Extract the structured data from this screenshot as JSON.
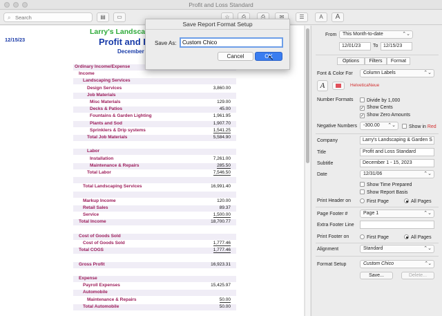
{
  "window": {
    "title": "Profit and Loss Standard"
  },
  "toolbar": {
    "search_placeholder": "Search",
    "search_icon": "magnifier-icon",
    "buttons": [
      "customize-report-icon",
      "sidebar-icon",
      "star-icon",
      "memorize-icon",
      "print-icon",
      "email-icon",
      "comment-icon",
      "font-small-icon",
      "font-large-icon"
    ],
    "font_small_glyph": "A",
    "font_large_glyph": "A"
  },
  "report": {
    "date": "12/15/23",
    "company": "Larry's Landscaping",
    "title": "Profit and Lo",
    "subtitle": "December",
    "rows": [
      {
        "label": "Ordinary Income/Expense",
        "amount": "",
        "indent": 0
      },
      {
        "label": "Income",
        "amount": "",
        "indent": 1
      },
      {
        "label": "Landscaping Services",
        "amount": "",
        "indent": 2
      },
      {
        "label": "Design Services",
        "amount": "3,860.00",
        "indent": 3
      },
      {
        "label": "Job Materials",
        "amount": "",
        "indent": 3
      },
      {
        "label": "Misc Materials",
        "amount": "129.00",
        "indent": 4
      },
      {
        "label": "Decks & Patios",
        "amount": "45.00",
        "indent": 4
      },
      {
        "label": "Fountains & Garden Lighting",
        "amount": "1,961.95",
        "indent": 4
      },
      {
        "label": "Plants and Sod",
        "amount": "1,907.70",
        "indent": 4
      },
      {
        "label": "Sprinklers & Drip systems",
        "amount": "1,541.25",
        "indent": 4
      },
      {
        "label": "Total Job Materials",
        "amount": "5,584.90",
        "indent": 3
      },
      {
        "label": "",
        "amount": "",
        "indent": 0
      },
      {
        "label": "Labor",
        "amount": "",
        "indent": 3
      },
      {
        "label": "Installation",
        "amount": "7,261.00",
        "indent": 4
      },
      {
        "label": "Maintenance & Repairs",
        "amount": "285.50",
        "indent": 4
      },
      {
        "label": "Total Labor",
        "amount": "7,546.50",
        "indent": 3
      },
      {
        "label": "",
        "amount": "",
        "indent": 0
      },
      {
        "label": "Total Landscaping Services",
        "amount": "16,991.40",
        "indent": 2
      },
      {
        "label": "",
        "amount": "",
        "indent": 0
      },
      {
        "label": "Markup Income",
        "amount": "120.00",
        "indent": 2
      },
      {
        "label": "Retail Sales",
        "amount": "89.37",
        "indent": 2
      },
      {
        "label": "Service",
        "amount": "1,500.00",
        "indent": 2
      },
      {
        "label": "Total Income",
        "amount": "18,700.77",
        "indent": 1
      },
      {
        "label": "",
        "amount": "",
        "indent": 0
      },
      {
        "label": "Cost of Goods Sold",
        "amount": "",
        "indent": 1
      },
      {
        "label": "Cost of Goods Sold",
        "amount": "1,777.46",
        "indent": 2
      },
      {
        "label": "Total COGS",
        "amount": "1,777.46",
        "indent": 1
      },
      {
        "label": "",
        "amount": "",
        "indent": 0
      },
      {
        "label": "Gross Profit",
        "amount": "16,923.31",
        "indent": 1
      },
      {
        "label": "",
        "amount": "",
        "indent": 0
      },
      {
        "label": "Expense",
        "amount": "",
        "indent": 1
      },
      {
        "label": "Payroll Expenses",
        "amount": "15,425.97",
        "indent": 2
      },
      {
        "label": "Automobile",
        "amount": "",
        "indent": 2
      },
      {
        "label": "Maintenance & Repairs",
        "amount": "50.00",
        "indent": 3
      },
      {
        "label": "Total Automobile",
        "amount": "50.00",
        "indent": 2
      }
    ]
  },
  "panel": {
    "from_label": "From",
    "date_range": "This Month-to-date",
    "from_date": "12/01/23",
    "to_label": "To",
    "to_date": "12/15/23",
    "tabs": [
      "Options",
      "Filters",
      "Format"
    ],
    "font_color_for_label": "Font & Color For",
    "font_color_for_value": "Column Labels",
    "font_glyph": "A",
    "font_name": "HelveticaNeue",
    "number_formats_label": "Number Formats",
    "divide_by_1000": "Divide by 1,000",
    "show_cents": "Show Cents",
    "show_zero_amounts": "Show Zero Amounts",
    "negative_numbers_label": "Negative Numbers",
    "negative_numbers_value": "-300.00",
    "show_in_red": "Show in",
    "red_word": "Red",
    "company_label": "Company",
    "company_value": "Larry's Landscaping & Garden S",
    "title_label": "Title",
    "title_value": "Profit and Loss Standard",
    "subtitle_label": "Subtitle",
    "subtitle_value": "December 1 - 15, 2023",
    "date_label": "Date",
    "date_value": "12/31/06",
    "show_time_prepared": "Show Time Prepared",
    "show_report_basis": "Show Report Basis",
    "print_header_on_label": "Print Header on",
    "first_page": "First Page",
    "all_pages": "All Pages",
    "page_footer_label": "Page Footer #",
    "page_footer_value": "Page 1",
    "extra_footer_label": "Extra Footer Line",
    "extra_footer_value": "",
    "print_footer_on_label": "Print Footer on",
    "alignment_label": "Alignment",
    "alignment_value": "Standard",
    "format_setup_label": "Format Setup",
    "format_setup_value": "Custom Chico",
    "save_button": "Save...",
    "delete_button": "Delete...",
    "chevron_glyph": "⌃⌄",
    "check_glyph": "✓"
  },
  "dialog": {
    "title": "Save Report Format Setup",
    "save_as_label": "Save As:",
    "save_as_value": "Custom Chico",
    "cancel_button": "Cancel",
    "ok_button": "OK"
  },
  "colors": {
    "accent": "#3a7df0",
    "account_text": "#9c1c5a",
    "company_green": "#2faa3a",
    "title_blue": "#173aa8"
  }
}
